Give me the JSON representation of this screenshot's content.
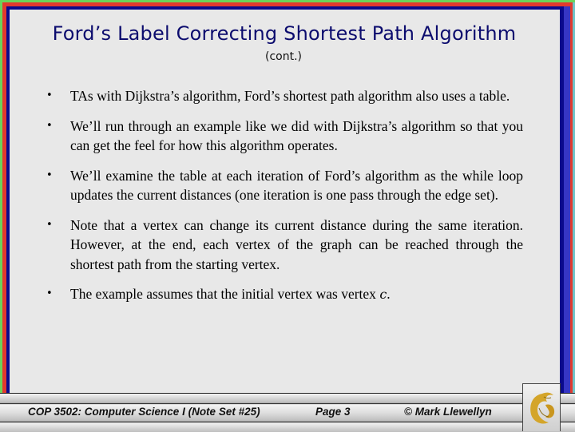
{
  "slide": {
    "title": "Ford’s Label Correcting Shortest Path Algorithm",
    "subtitle": "(cont.)",
    "bullets": [
      {
        "text": "TAs with Dijkstra’s algorithm, Ford’s shortest path algorithm also uses a table."
      },
      {
        "text": "We’ll run through an example like we did with Dijkstra’s algorithm so that you can get the feel for how this algorithm operates."
      },
      {
        "text": "We’ll examine the table at each iteration of Ford’s algorithm as the while loop updates the current distances (one iteration is one pass through the edge set)."
      },
      {
        "text": "Note that a vertex can change its current distance during the same iteration.  However, at the end, each vertex of the graph can be reached through the shortest path from the starting vertex."
      },
      {
        "text": "The example assumes that the initial vertex was vertex ",
        "vertex": "c",
        "suffix": "."
      }
    ],
    "bullet_glyph": "•"
  },
  "footer": {
    "course": "COP 3502: Computer Science I  (Note Set #25)",
    "page": "Page 3",
    "copyright": "© Mark Llewellyn",
    "logo_icon": "pegasus-logo-icon"
  },
  "colors": {
    "title": "#0c0c6e",
    "border_green": "#6bd35a",
    "border_red": "#e23a2e",
    "border_navy": "#0a0a8c",
    "border_blue": "#3636c4",
    "logo_gold": "#d4a52a"
  }
}
